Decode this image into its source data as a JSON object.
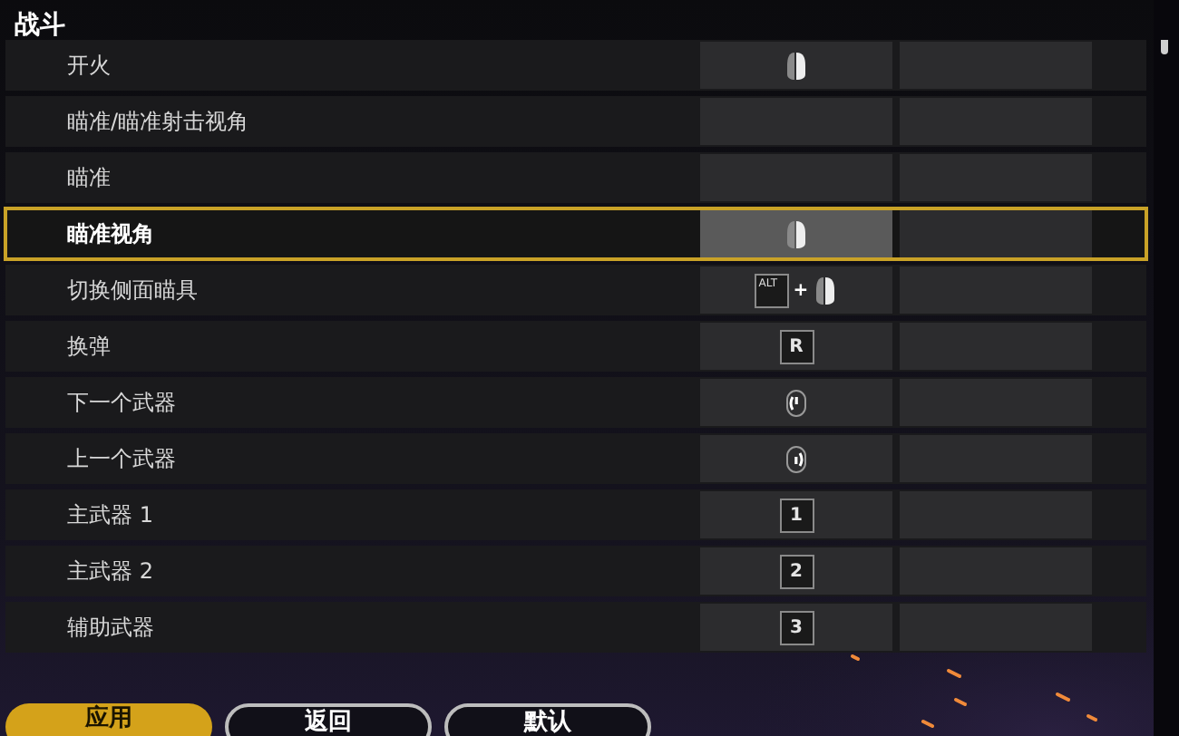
{
  "section": {
    "title": "战斗"
  },
  "rows": [
    {
      "label": "开火",
      "selected": false,
      "binding": {
        "kind": "mouse"
      }
    },
    {
      "label": "瞄准/瞄准射击视角",
      "selected": false
    },
    {
      "label": "瞄准",
      "selected": false
    },
    {
      "label": "瞄准视角",
      "selected": true,
      "binding": {
        "kind": "mouse"
      }
    },
    {
      "label": "切换侧面瞄具",
      "selected": false,
      "binding": {
        "kind": "combo",
        "key": "ALT",
        "joiner": "+"
      }
    },
    {
      "label": "换弹",
      "selected": false,
      "binding": {
        "kind": "key",
        "key": "R"
      }
    },
    {
      "label": "下一个武器",
      "selected": false,
      "binding": {
        "kind": "wheel-up"
      }
    },
    {
      "label": "上一个武器",
      "selected": false,
      "binding": {
        "kind": "wheel-down"
      }
    },
    {
      "label": "主武器 1",
      "selected": false,
      "binding": {
        "kind": "key",
        "key": "1"
      }
    },
    {
      "label": "主武器 2",
      "selected": false,
      "binding": {
        "kind": "key",
        "key": "2"
      }
    },
    {
      "label": "辅助武器",
      "selected": false,
      "binding": {
        "kind": "key",
        "key": "3"
      }
    }
  ],
  "buttons": [
    {
      "label": "应用",
      "kind": "primary"
    },
    {
      "label": "返回",
      "kind": "outline"
    },
    {
      "label": "默认",
      "kind": "outline"
    }
  ]
}
